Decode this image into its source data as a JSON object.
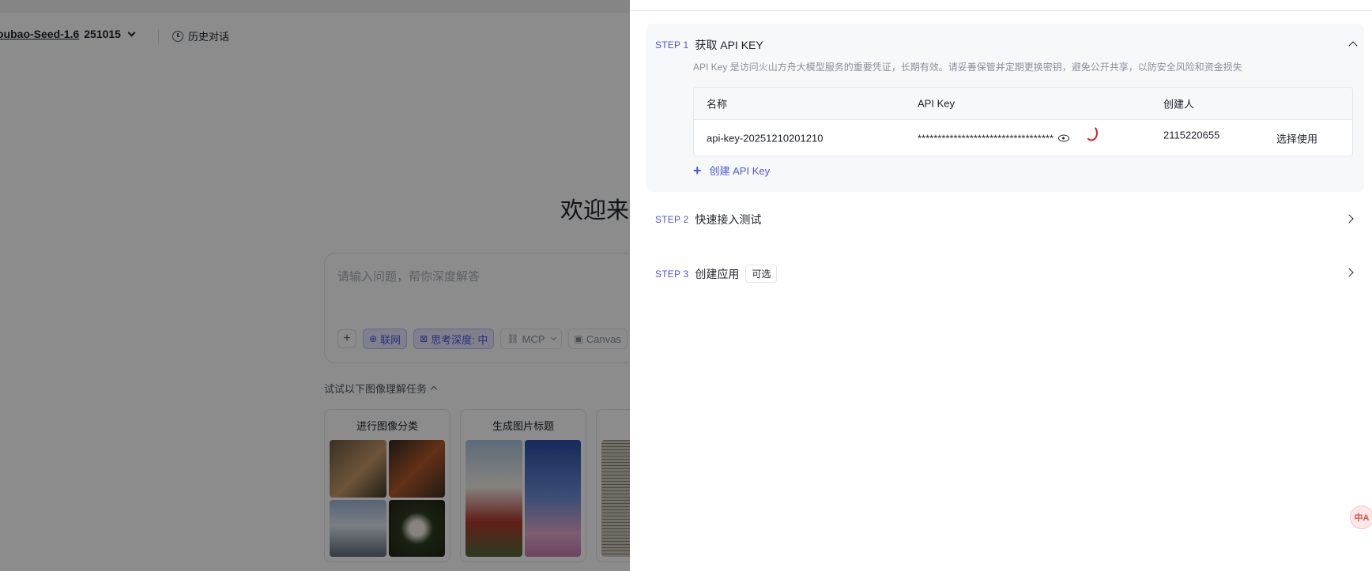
{
  "background": {
    "model": {
      "name": "oubao-Seed-1.6",
      "version": "251015"
    },
    "history_label": "历史对话",
    "welcome_text": "欢迎来到",
    "input": {
      "placeholder": "请输入问题，帮你深度解答",
      "tools": [
        {
          "label": "+",
          "active": false
        },
        {
          "label": "联网",
          "active": true,
          "icon": "globe-icon"
        },
        {
          "label": "思考深度: 中",
          "active": true,
          "icon": "think-icon"
        },
        {
          "label": "MCP",
          "active": false,
          "icon": "link-icon"
        },
        {
          "label": "Canvas",
          "active": false,
          "icon": "canvas-icon"
        }
      ]
    },
    "try_label": "试试以下图像理解任务",
    "tasks": [
      {
        "title": "进行图像分类"
      },
      {
        "title": "生成图片标题"
      },
      {
        "title": ""
      }
    ]
  },
  "drawer": {
    "steps": [
      {
        "tag": "STEP 1",
        "title": "获取 API KEY",
        "expanded": true
      },
      {
        "tag": "STEP 2",
        "title": "快速接入测试",
        "expanded": false
      },
      {
        "tag": "STEP 3",
        "title": "创建应用",
        "badge": "可选",
        "expanded": false
      }
    ],
    "step1_desc": "API Key 是访问火山方舟大模型服务的重要凭证，长期有效。请妥善保管并定期更换密钥，避免公开共享，以防安全风险和资金损失",
    "table": {
      "headers": [
        "名称",
        "API Key",
        "创建人",
        ""
      ],
      "rows": [
        {
          "name": "api-key-20251210201210",
          "key": "**********************************",
          "creator": "2115220655",
          "action": "选择使用"
        }
      ]
    },
    "create_label": "创建 API Key"
  },
  "colors": {
    "accent": "#4b56e6",
    "overlay": "rgba(0,0,0,0.45)",
    "annotation": "#d91f1f"
  },
  "fab": {
    "label": "中A",
    "icon": "translate-icon"
  }
}
